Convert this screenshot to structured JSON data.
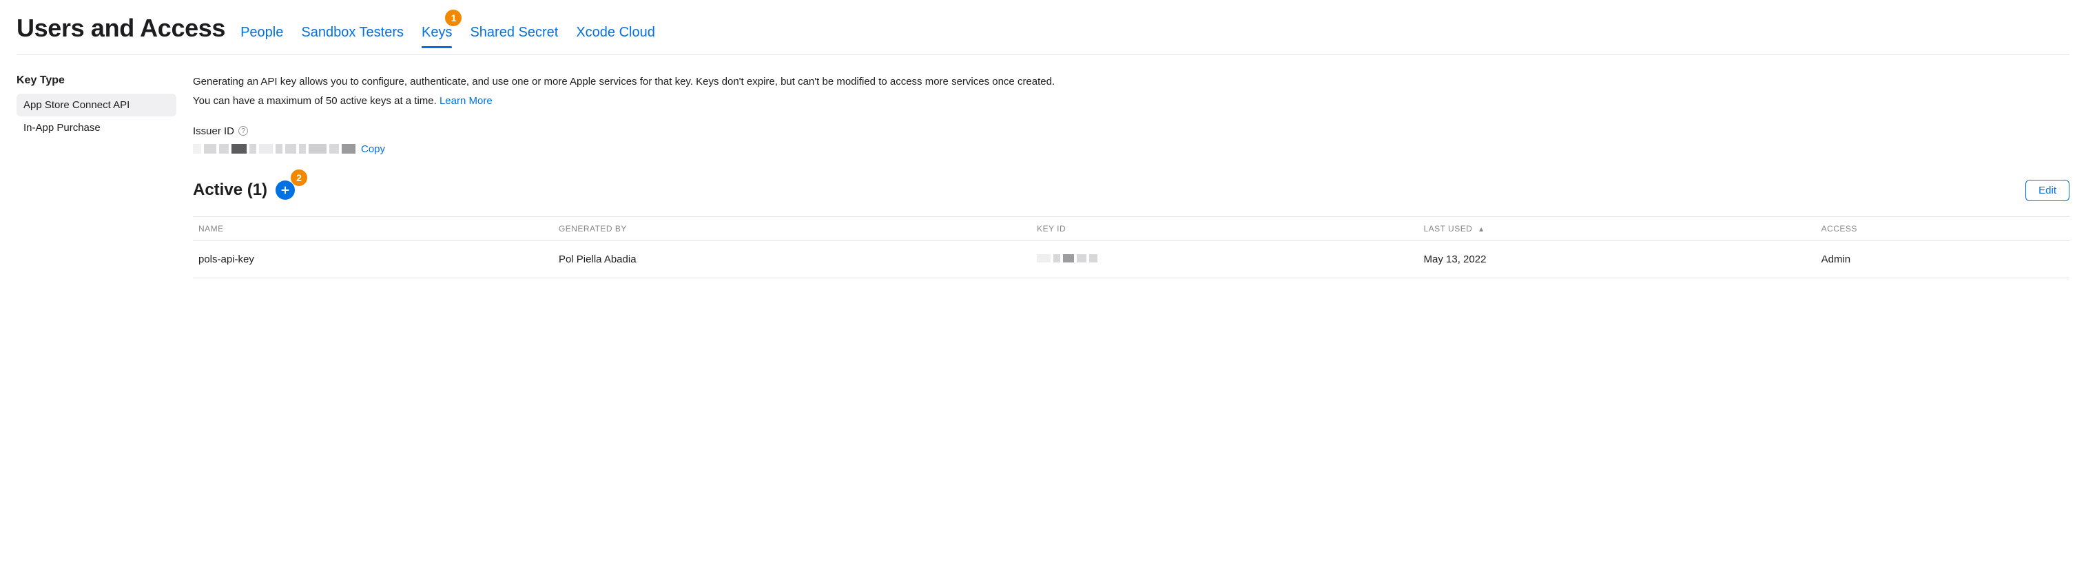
{
  "colors": {
    "accent": "#0071e3",
    "badge": "#f28700"
  },
  "header": {
    "title": "Users and Access",
    "tabs": [
      {
        "label": "People"
      },
      {
        "label": "Sandbox Testers"
      },
      {
        "label": "Keys",
        "active": true,
        "step": "1"
      },
      {
        "label": "Shared Secret"
      },
      {
        "label": "Xcode Cloud"
      }
    ]
  },
  "sidebar": {
    "title": "Key Type",
    "items": [
      {
        "label": "App Store Connect API",
        "selected": true
      },
      {
        "label": "In-App Purchase",
        "selected": false
      }
    ]
  },
  "main": {
    "description_line1": "Generating an API key allows you to configure, authenticate, and use one or more Apple services for that key. Keys don't expire, but can't be modified to access more services once created.",
    "description_line2_prefix": "You can have a maximum of 50 active keys at a time. ",
    "learn_more": "Learn More",
    "issuer_label": "Issuer ID",
    "copy_label": "Copy",
    "active_title": "Active (1)",
    "add_step": "2",
    "edit_label": "Edit",
    "table": {
      "columns": [
        {
          "label": "NAME"
        },
        {
          "label": "GENERATED BY"
        },
        {
          "label": "KEY ID"
        },
        {
          "label": "LAST USED",
          "sort": "asc"
        },
        {
          "label": "ACCESS"
        }
      ],
      "rows": [
        {
          "name": "pols-api-key",
          "generated_by": "Pol Piella Abadia",
          "key_id": "",
          "last_used": "May 13, 2022",
          "access": "Admin"
        }
      ]
    }
  }
}
